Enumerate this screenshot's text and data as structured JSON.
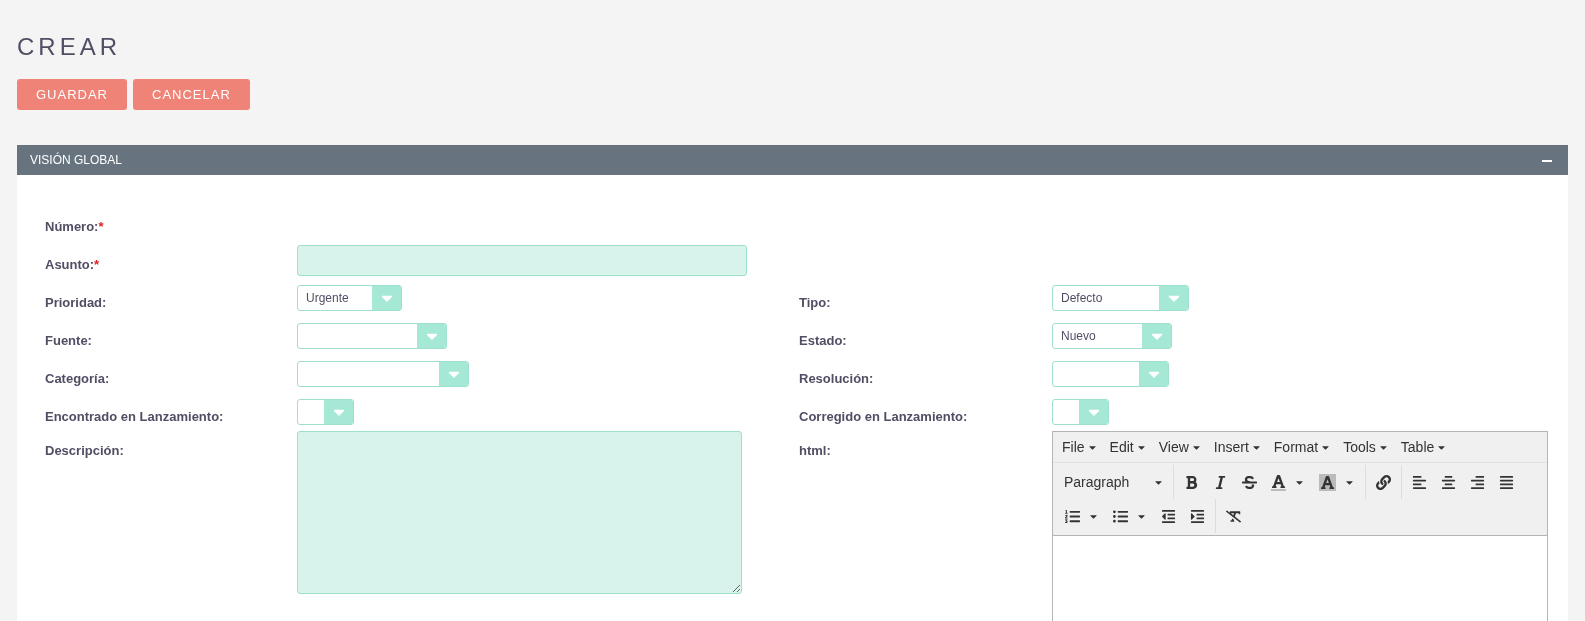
{
  "title": "CREAR",
  "buttons": [
    {
      "label": "GUARDAR"
    },
    {
      "label": "CANCELAR"
    }
  ],
  "panel": {
    "title": "VISIÓN GLOBAL",
    "expanded": true,
    "rows": [
      {
        "left": {
          "label": "Número:",
          "required_mark": "*",
          "kind": "none"
        }
      },
      {
        "left": {
          "label": "Asunto:",
          "required_mark": "*",
          "kind": "text"
        }
      },
      {
        "left": {
          "label": "Prioridad:",
          "kind": "select",
          "value": "Urgente"
        },
        "right": {
          "label": "Tipo:",
          "kind": "select",
          "value": "Defecto"
        }
      },
      {
        "left": {
          "label": "Fuente:",
          "kind": "select"
        },
        "right": {
          "label": "Estado:",
          "kind": "select",
          "value": "Nuevo"
        }
      },
      {
        "left": {
          "label": "Categoría:",
          "kind": "select"
        },
        "right": {
          "label": "Resolución:",
          "kind": "select"
        }
      },
      {
        "left": {
          "label": "Encontrado en Lanzamiento:",
          "kind": "select"
        },
        "right": {
          "label": "Corregido en Lanzamiento:",
          "kind": "select"
        }
      },
      {
        "left": {
          "label": "Descripción:",
          "kind": "textarea"
        },
        "right": {
          "label": "html:",
          "kind": "editor",
          "menus": [
            "File",
            "Edit",
            "View",
            "Insert",
            "Format",
            "Tools",
            "Table"
          ],
          "block_format": "Paragraph"
        }
      }
    ]
  }
}
